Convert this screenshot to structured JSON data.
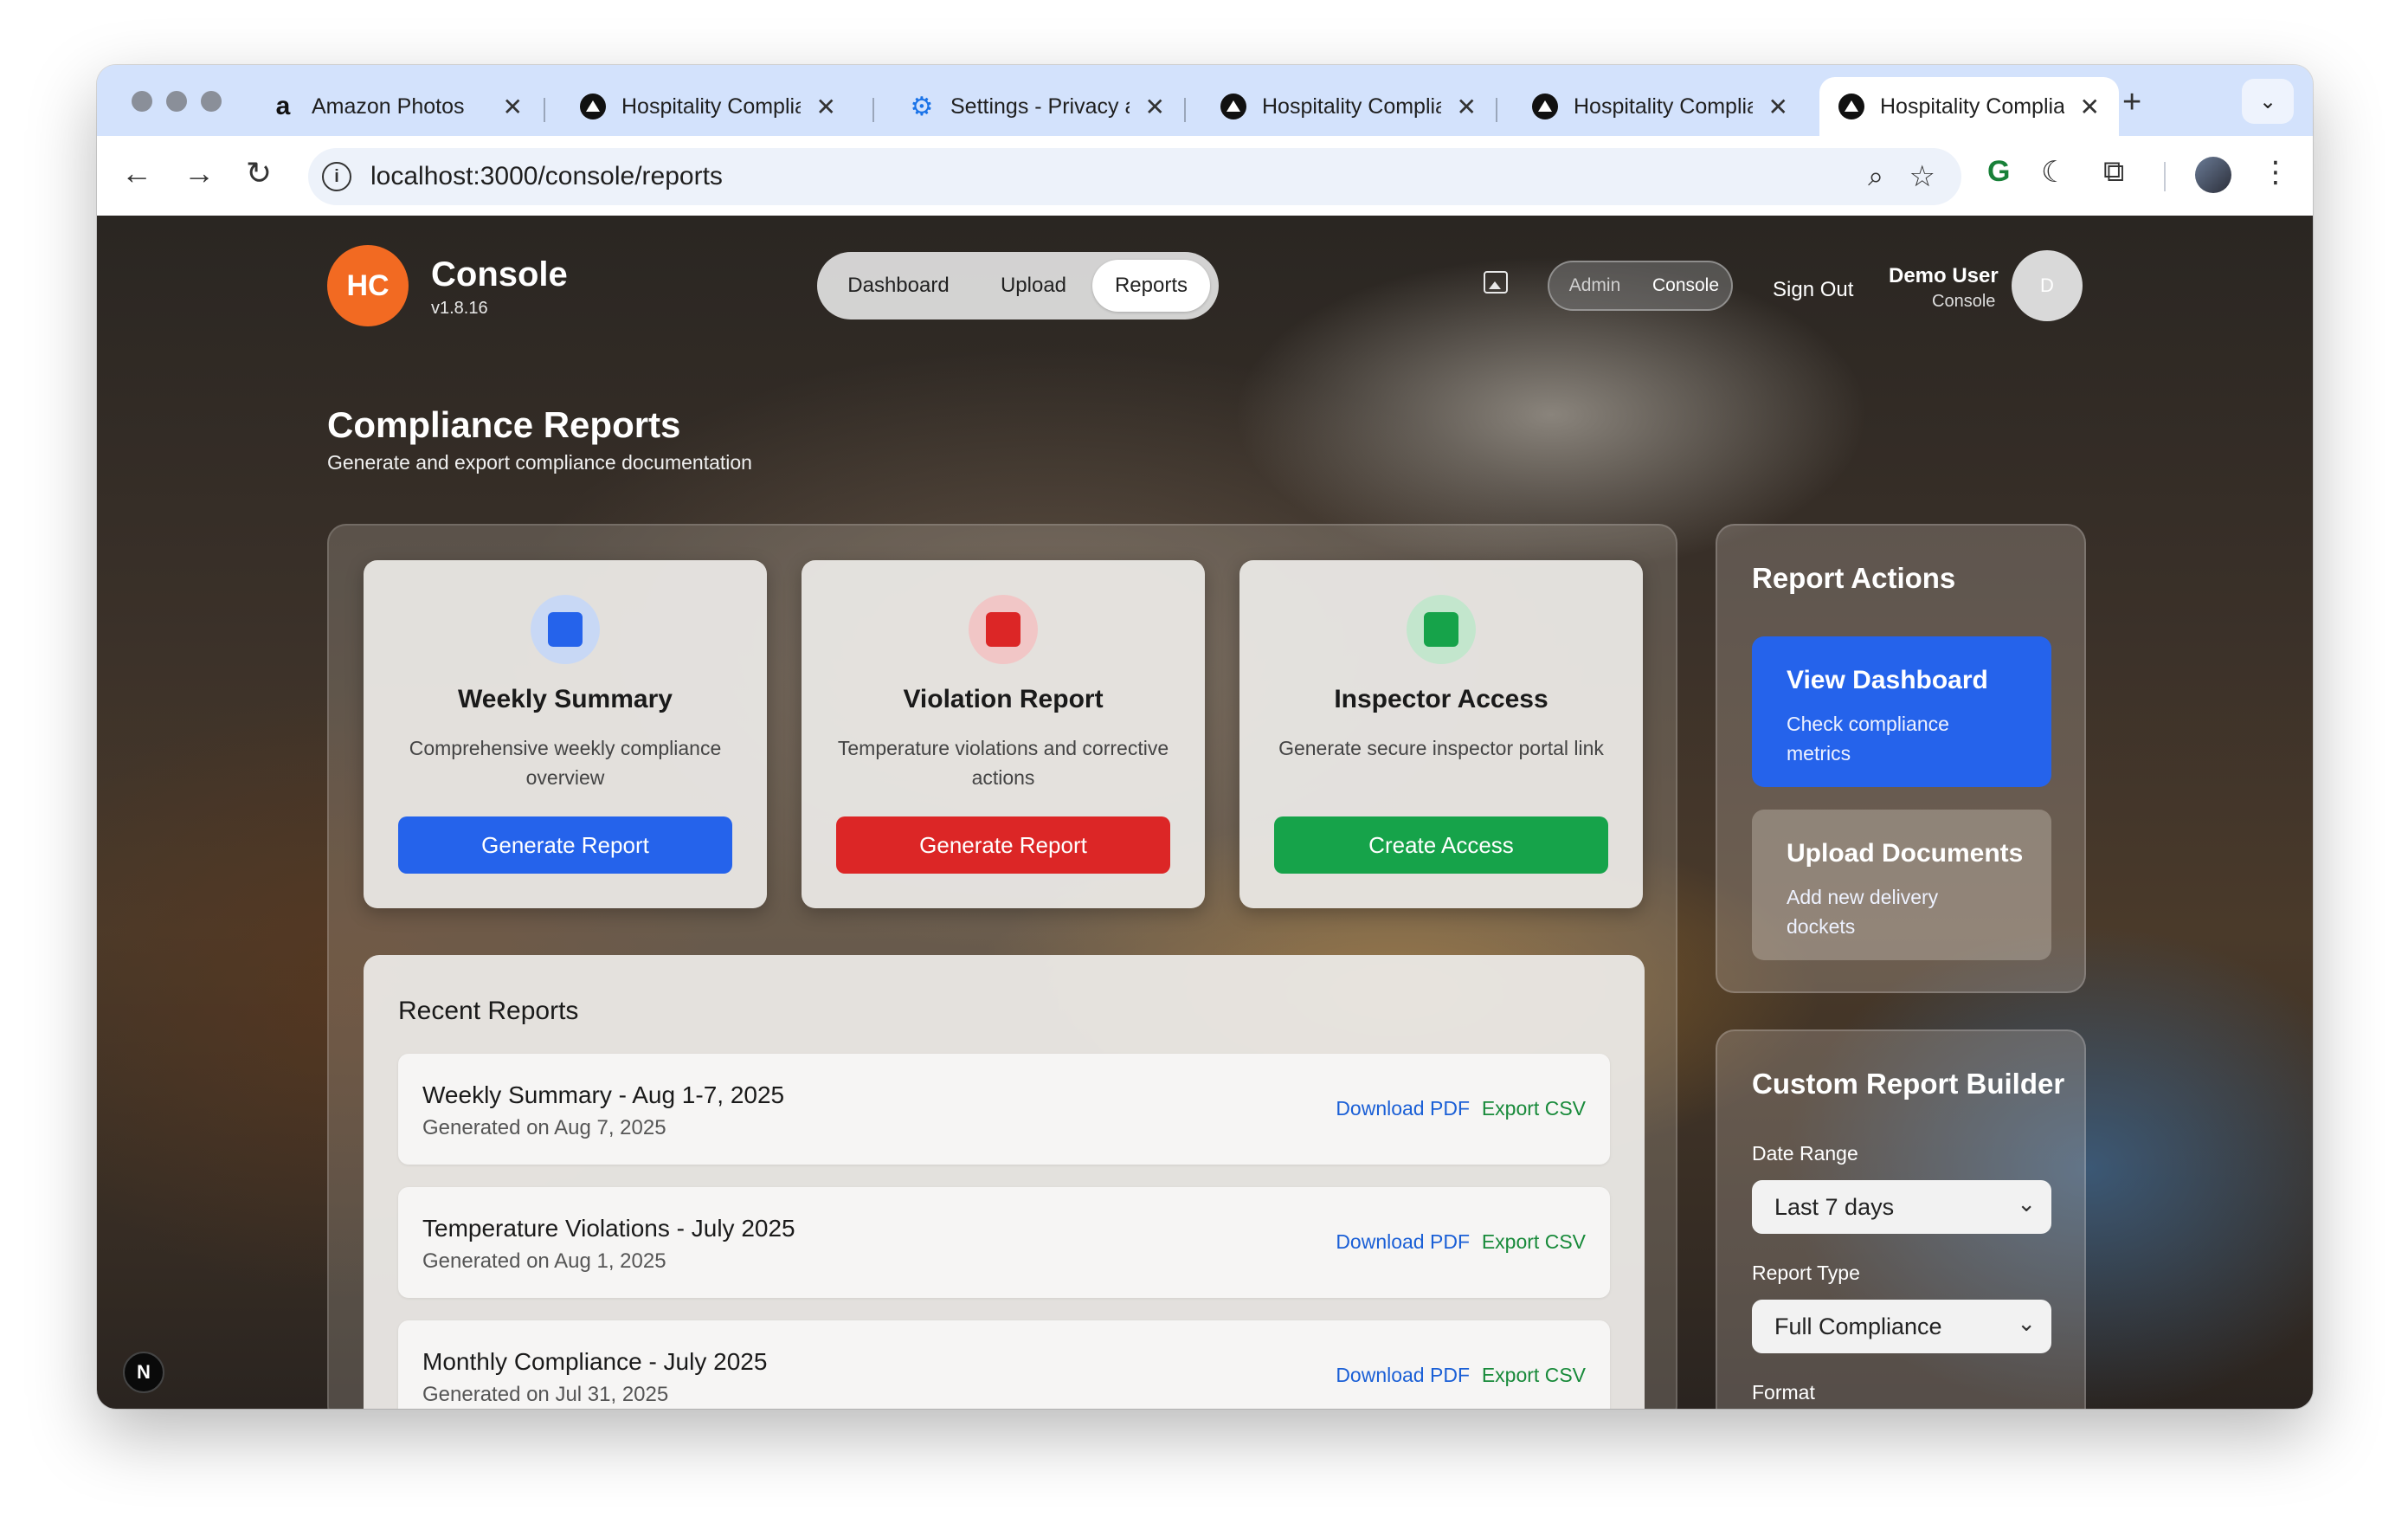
{
  "browser": {
    "tabs": [
      {
        "title": "Amazon Photos",
        "icon": "amazon-icon"
      },
      {
        "title": "Hospitality Complia",
        "icon": "vercel-icon"
      },
      {
        "title": "Settings - Privacy a",
        "icon": "gear-icon"
      },
      {
        "title": "Hospitality Complia",
        "icon": "vercel-icon"
      },
      {
        "title": "Hospitality Complia",
        "icon": "vercel-icon"
      },
      {
        "title": "Hospitality Complia",
        "icon": "vercel-icon"
      }
    ],
    "active_tab_index": 5,
    "url": "localhost:3000/console/reports"
  },
  "app": {
    "logo_text": "HC",
    "brand": "Console",
    "version": "v1.8.16",
    "nav": [
      "Dashboard",
      "Upload",
      "Reports"
    ],
    "active_nav": "Reports",
    "mode_toggle": [
      "Admin",
      "Console"
    ],
    "active_mode": "Console",
    "sign_out": "Sign Out",
    "user": {
      "name": "Demo User",
      "role": "Console",
      "avatar_letter": "D"
    }
  },
  "page": {
    "title": "Compliance Reports",
    "subtitle": "Generate and export compliance documentation"
  },
  "cards": [
    {
      "title": "Weekly Summary",
      "desc": "Comprehensive weekly compliance overview",
      "button": "Generate Report",
      "color": "#2563eb",
      "tint": "#c8d8f5"
    },
    {
      "title": "Violation Report",
      "desc": "Temperature violations and corrective actions",
      "button": "Generate Report",
      "color": "#dc2626",
      "tint": "#f1c6c6"
    },
    {
      "title": "Inspector Access",
      "desc": "Generate secure inspector portal link",
      "button": "Create Access",
      "color": "#16a34a",
      "tint": "#c3e6cd"
    }
  ],
  "recent": {
    "heading": "Recent Reports",
    "download_label": "Download PDF",
    "export_label": "Export CSV",
    "items": [
      {
        "name": "Weekly Summary - Aug 1-7, 2025",
        "generated": "Generated on Aug 7, 2025"
      },
      {
        "name": "Temperature Violations - July 2025",
        "generated": "Generated on Aug 1, 2025"
      },
      {
        "name": "Monthly Compliance - July 2025",
        "generated": "Generated on Jul 31, 2025"
      }
    ]
  },
  "report_actions": {
    "heading": "Report Actions",
    "items": [
      {
        "title": "View Dashboard",
        "desc": "Check compliance metrics",
        "color": "#2563eb"
      },
      {
        "title": "Upload Documents",
        "desc": "Add new delivery dockets",
        "color": "rgba(210,200,190,0.35)"
      }
    ]
  },
  "builder": {
    "heading": "Custom Report Builder",
    "date_range_label": "Date Range",
    "date_range_value": "Last 7 days",
    "report_type_label": "Report Type",
    "report_type_value": "Full Compliance",
    "format_label": "Format"
  },
  "dev_indicator": "N"
}
